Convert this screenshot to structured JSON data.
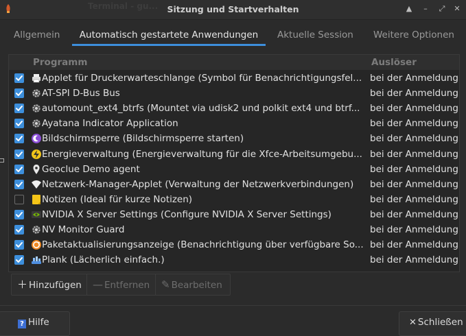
{
  "window": {
    "title": "Sitzung und Startverhalten",
    "ghost_title": "Terminal - gu..."
  },
  "tabs": [
    {
      "label": "Allgemein",
      "active": false
    },
    {
      "label": "Automatisch gestartete Anwendungen",
      "active": true
    },
    {
      "label": "Aktuelle Session",
      "active": false
    },
    {
      "label": "Weitere Optionen",
      "active": false
    }
  ],
  "list": {
    "col_program": "Programm",
    "col_trigger": "Auslöser",
    "rows": [
      {
        "checked": true,
        "icon": "printer-icon",
        "name": "Applet für Druckerwarteschlange (Symbol für Benachrichtigungsfel...",
        "trigger": "bei der Anmeldung"
      },
      {
        "checked": true,
        "icon": "gear-icon",
        "name": "AT-SPI D-Bus Bus",
        "trigger": "bei der Anmeldung"
      },
      {
        "checked": true,
        "icon": "gear-icon",
        "name": "automount_ext4_btrfs (Mountet via udisk2 und polkit ext4 und btrf...",
        "trigger": "bei der Anmeldung"
      },
      {
        "checked": true,
        "icon": "gear-icon",
        "name": "Ayatana Indicator Application",
        "trigger": "bei der Anmeldung"
      },
      {
        "checked": true,
        "icon": "screensaver-icon",
        "name": "Bildschirmsperre (Bildschirmsperre starten)",
        "trigger": "bei der Anmeldung"
      },
      {
        "checked": true,
        "icon": "power-icon",
        "name": "Energieverwaltung (Energieverwaltung für die Xfce-Arbeitsumgebu...",
        "trigger": "bei der Anmeldung"
      },
      {
        "checked": true,
        "icon": "location-pin-icon",
        "name": "Geoclue Demo agent",
        "trigger": "bei der Anmeldung"
      },
      {
        "checked": true,
        "icon": "wifi-icon",
        "name": "Netzwerk-Manager-Applet (Verwaltung der Netzwerkverbindungen)",
        "trigger": "bei der Anmeldung"
      },
      {
        "checked": false,
        "icon": "note-icon",
        "name": "Notizen (Ideal für kurze Notizen)",
        "trigger": "bei der Anmeldung"
      },
      {
        "checked": true,
        "icon": "nvidia-icon",
        "name": "NVIDIA X Server Settings (Configure NVIDIA X Server Settings)",
        "trigger": "bei der Anmeldung"
      },
      {
        "checked": true,
        "icon": "gear-icon",
        "name": "NV Monitor Guard",
        "trigger": "bei der Anmeldung"
      },
      {
        "checked": true,
        "icon": "update-icon",
        "name": "Paketaktualisierungsanzeige (Benachrichtigung über verfügbare So...",
        "trigger": "bei der Anmeldung"
      },
      {
        "checked": true,
        "icon": "dock-icon",
        "name": "Plank (Lächerlich einfach.)",
        "trigger": "bei der Anmeldung"
      }
    ]
  },
  "toolbar": {
    "add": "Hinzufügen",
    "remove": "Entfernen",
    "edit": "Bearbeiten"
  },
  "buttons": {
    "help": "Hilfe",
    "close": "Schließen"
  },
  "colors": {
    "accent": "#3d8fdc",
    "background": "#2b2b2b"
  }
}
